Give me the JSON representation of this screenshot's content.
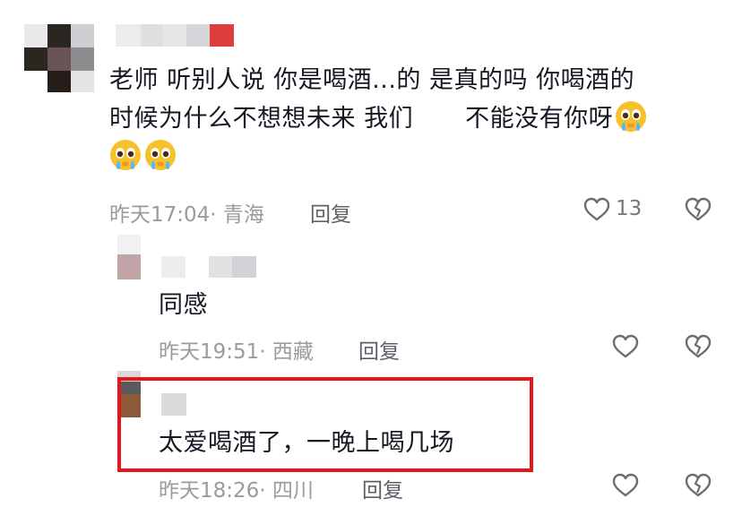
{
  "comments": [
    {
      "text_line1": "老师  听别人说 你是喝酒...的  是真的吗  你喝酒的",
      "text_line2_a": "时候为什么不想想未来  我们",
      "text_line2_b": "不能没有你呀",
      "meta": "昨天17:04· 青海",
      "reply_label": "回复",
      "like_count": "13"
    },
    {
      "text": "同感",
      "meta": "昨天19:51· 西藏",
      "reply_label": "回复"
    },
    {
      "text": "太爱喝酒了，一晚上喝几场",
      "meta": "昨天18:26· 四川",
      "reply_label": "回复"
    }
  ],
  "icons": {
    "heart": "heart-outline-icon",
    "dislike": "broken-heart-icon",
    "emoji": "pleading-face-emoji"
  },
  "colors": {
    "highlight": "#e8141b",
    "meta": "#9a9ba1",
    "text": "#161823"
  }
}
